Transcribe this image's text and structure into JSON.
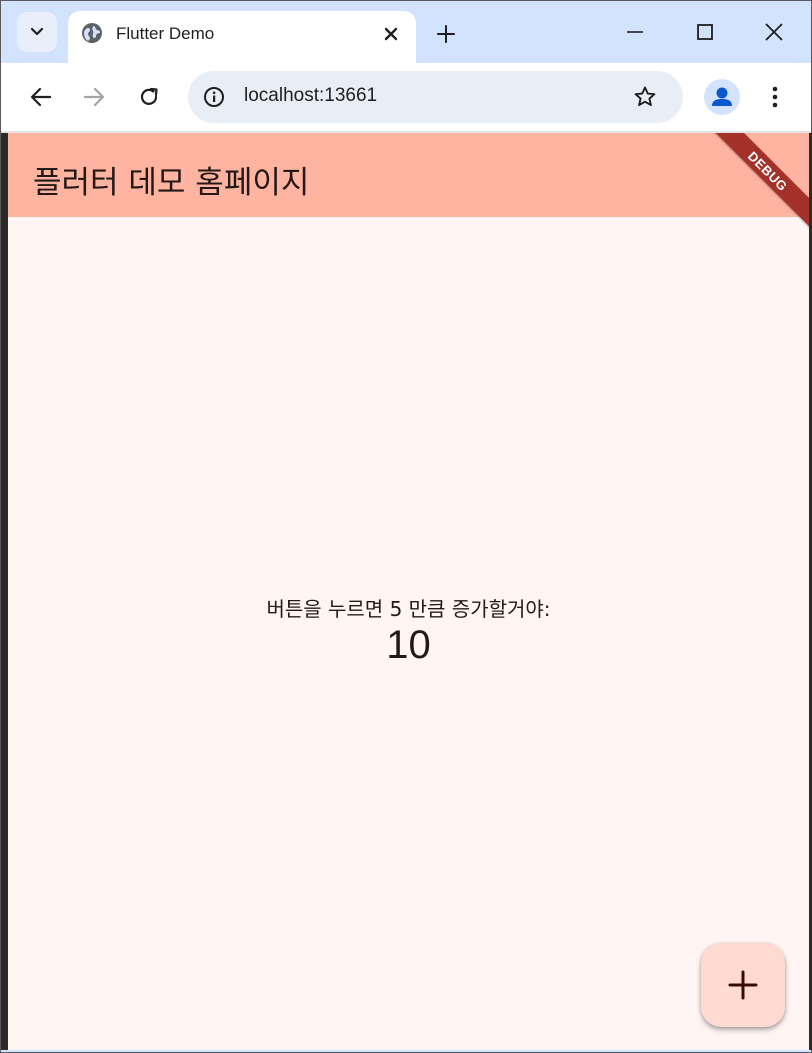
{
  "browser": {
    "tab": {
      "title": "Flutter Demo",
      "favicon": "globe-icon"
    },
    "omnibox": {
      "url": "localhost:13661"
    },
    "icons": {
      "tab_search": "chevron-down-icon",
      "close_tab": "close-icon",
      "new_tab": "plus-icon",
      "minimize": "minimize-icon",
      "maximize": "maximize-icon",
      "close_window": "close-icon",
      "back": "arrow-left-icon",
      "forward": "arrow-right-icon",
      "reload": "reload-icon",
      "site_info": "info-icon",
      "bookmark": "star-icon",
      "profile": "person-icon",
      "menu": "more-vert-icon"
    },
    "colors": {
      "tabstrip": "#d3e3fd",
      "toolbar": "#ffffff",
      "omnibox": "#e9eef6",
      "profile_accent": "#0b57d0"
    }
  },
  "app": {
    "appbar_title": "플러터 데모 홈페이지",
    "debug_banner": "DEBUG",
    "message": "버튼을 누르면 5 만큼 증가할거야:",
    "counter": "10",
    "fab_icon": "plus-icon",
    "colors": {
      "appbar": "#ffb4a1",
      "background": "#fff5f3",
      "fab": "#ffdad2",
      "debug_banner": "#a3312a"
    }
  }
}
